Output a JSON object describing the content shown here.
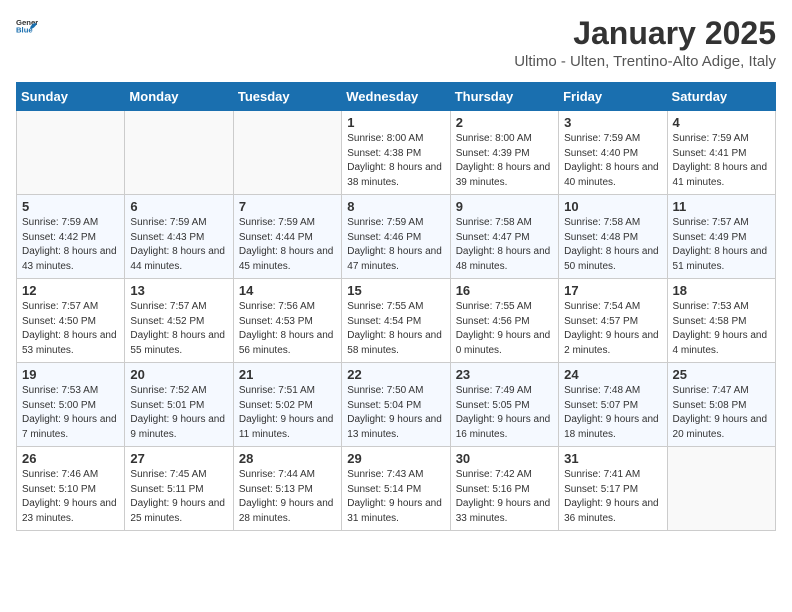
{
  "header": {
    "logo_general": "General",
    "logo_blue": "Blue",
    "month": "January 2025",
    "location": "Ultimo - Ulten, Trentino-Alto Adige, Italy"
  },
  "weekdays": [
    "Sunday",
    "Monday",
    "Tuesday",
    "Wednesday",
    "Thursday",
    "Friday",
    "Saturday"
  ],
  "weeks": [
    [
      {
        "day": "",
        "sunrise": "",
        "sunset": "",
        "daylight": ""
      },
      {
        "day": "",
        "sunrise": "",
        "sunset": "",
        "daylight": ""
      },
      {
        "day": "",
        "sunrise": "",
        "sunset": "",
        "daylight": ""
      },
      {
        "day": "1",
        "sunrise": "Sunrise: 8:00 AM",
        "sunset": "Sunset: 4:38 PM",
        "daylight": "Daylight: 8 hours and 38 minutes."
      },
      {
        "day": "2",
        "sunrise": "Sunrise: 8:00 AM",
        "sunset": "Sunset: 4:39 PM",
        "daylight": "Daylight: 8 hours and 39 minutes."
      },
      {
        "day": "3",
        "sunrise": "Sunrise: 7:59 AM",
        "sunset": "Sunset: 4:40 PM",
        "daylight": "Daylight: 8 hours and 40 minutes."
      },
      {
        "day": "4",
        "sunrise": "Sunrise: 7:59 AM",
        "sunset": "Sunset: 4:41 PM",
        "daylight": "Daylight: 8 hours and 41 minutes."
      }
    ],
    [
      {
        "day": "5",
        "sunrise": "Sunrise: 7:59 AM",
        "sunset": "Sunset: 4:42 PM",
        "daylight": "Daylight: 8 hours and 43 minutes."
      },
      {
        "day": "6",
        "sunrise": "Sunrise: 7:59 AM",
        "sunset": "Sunset: 4:43 PM",
        "daylight": "Daylight: 8 hours and 44 minutes."
      },
      {
        "day": "7",
        "sunrise": "Sunrise: 7:59 AM",
        "sunset": "Sunset: 4:44 PM",
        "daylight": "Daylight: 8 hours and 45 minutes."
      },
      {
        "day": "8",
        "sunrise": "Sunrise: 7:59 AM",
        "sunset": "Sunset: 4:46 PM",
        "daylight": "Daylight: 8 hours and 47 minutes."
      },
      {
        "day": "9",
        "sunrise": "Sunrise: 7:58 AM",
        "sunset": "Sunset: 4:47 PM",
        "daylight": "Daylight: 8 hours and 48 minutes."
      },
      {
        "day": "10",
        "sunrise": "Sunrise: 7:58 AM",
        "sunset": "Sunset: 4:48 PM",
        "daylight": "Daylight: 8 hours and 50 minutes."
      },
      {
        "day": "11",
        "sunrise": "Sunrise: 7:57 AM",
        "sunset": "Sunset: 4:49 PM",
        "daylight": "Daylight: 8 hours and 51 minutes."
      }
    ],
    [
      {
        "day": "12",
        "sunrise": "Sunrise: 7:57 AM",
        "sunset": "Sunset: 4:50 PM",
        "daylight": "Daylight: 8 hours and 53 minutes."
      },
      {
        "day": "13",
        "sunrise": "Sunrise: 7:57 AM",
        "sunset": "Sunset: 4:52 PM",
        "daylight": "Daylight: 8 hours and 55 minutes."
      },
      {
        "day": "14",
        "sunrise": "Sunrise: 7:56 AM",
        "sunset": "Sunset: 4:53 PM",
        "daylight": "Daylight: 8 hours and 56 minutes."
      },
      {
        "day": "15",
        "sunrise": "Sunrise: 7:55 AM",
        "sunset": "Sunset: 4:54 PM",
        "daylight": "Daylight: 8 hours and 58 minutes."
      },
      {
        "day": "16",
        "sunrise": "Sunrise: 7:55 AM",
        "sunset": "Sunset: 4:56 PM",
        "daylight": "Daylight: 9 hours and 0 minutes."
      },
      {
        "day": "17",
        "sunrise": "Sunrise: 7:54 AM",
        "sunset": "Sunset: 4:57 PM",
        "daylight": "Daylight: 9 hours and 2 minutes."
      },
      {
        "day": "18",
        "sunrise": "Sunrise: 7:53 AM",
        "sunset": "Sunset: 4:58 PM",
        "daylight": "Daylight: 9 hours and 4 minutes."
      }
    ],
    [
      {
        "day": "19",
        "sunrise": "Sunrise: 7:53 AM",
        "sunset": "Sunset: 5:00 PM",
        "daylight": "Daylight: 9 hours and 7 minutes."
      },
      {
        "day": "20",
        "sunrise": "Sunrise: 7:52 AM",
        "sunset": "Sunset: 5:01 PM",
        "daylight": "Daylight: 9 hours and 9 minutes."
      },
      {
        "day": "21",
        "sunrise": "Sunrise: 7:51 AM",
        "sunset": "Sunset: 5:02 PM",
        "daylight": "Daylight: 9 hours and 11 minutes."
      },
      {
        "day": "22",
        "sunrise": "Sunrise: 7:50 AM",
        "sunset": "Sunset: 5:04 PM",
        "daylight": "Daylight: 9 hours and 13 minutes."
      },
      {
        "day": "23",
        "sunrise": "Sunrise: 7:49 AM",
        "sunset": "Sunset: 5:05 PM",
        "daylight": "Daylight: 9 hours and 16 minutes."
      },
      {
        "day": "24",
        "sunrise": "Sunrise: 7:48 AM",
        "sunset": "Sunset: 5:07 PM",
        "daylight": "Daylight: 9 hours and 18 minutes."
      },
      {
        "day": "25",
        "sunrise": "Sunrise: 7:47 AM",
        "sunset": "Sunset: 5:08 PM",
        "daylight": "Daylight: 9 hours and 20 minutes."
      }
    ],
    [
      {
        "day": "26",
        "sunrise": "Sunrise: 7:46 AM",
        "sunset": "Sunset: 5:10 PM",
        "daylight": "Daylight: 9 hours and 23 minutes."
      },
      {
        "day": "27",
        "sunrise": "Sunrise: 7:45 AM",
        "sunset": "Sunset: 5:11 PM",
        "daylight": "Daylight: 9 hours and 25 minutes."
      },
      {
        "day": "28",
        "sunrise": "Sunrise: 7:44 AM",
        "sunset": "Sunset: 5:13 PM",
        "daylight": "Daylight: 9 hours and 28 minutes."
      },
      {
        "day": "29",
        "sunrise": "Sunrise: 7:43 AM",
        "sunset": "Sunset: 5:14 PM",
        "daylight": "Daylight: 9 hours and 31 minutes."
      },
      {
        "day": "30",
        "sunrise": "Sunrise: 7:42 AM",
        "sunset": "Sunset: 5:16 PM",
        "daylight": "Daylight: 9 hours and 33 minutes."
      },
      {
        "day": "31",
        "sunrise": "Sunrise: 7:41 AM",
        "sunset": "Sunset: 5:17 PM",
        "daylight": "Daylight: 9 hours and 36 minutes."
      },
      {
        "day": "",
        "sunrise": "",
        "sunset": "",
        "daylight": ""
      }
    ]
  ]
}
